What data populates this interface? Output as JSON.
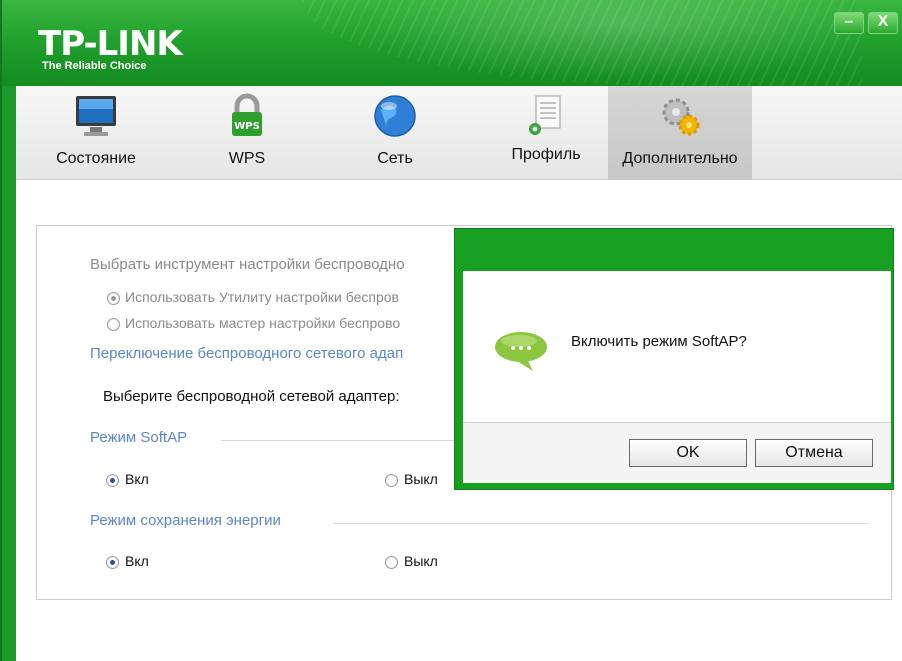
{
  "window": {
    "logo": "TP-LINK",
    "tagline": "The Reliable Choice",
    "minimize_glyph": "–",
    "close_glyph": "X"
  },
  "tabs": [
    {
      "label": "Состояние",
      "icon": "monitor-icon",
      "active": false
    },
    {
      "label": "WPS",
      "icon": "wps-lock-icon",
      "active": false
    },
    {
      "label": "Сеть",
      "icon": "globe-icon",
      "active": false
    },
    {
      "label": "Профиль",
      "icon": "profile-document-icon",
      "active": false
    },
    {
      "label": "Дополнительно",
      "icon": "gears-icon",
      "active": true
    }
  ],
  "panel": {
    "tool_heading": "Выбрать инструмент настройки беспроводно",
    "option_utility": "Использовать Утилиту настройки беспров",
    "option_wizard": "Использовать мастер настройки беспрово",
    "switch_adapter_heading": "Переключение беспроводного сетевого адап",
    "select_adapter_label": "Выберите беспроводной сетевой адаптер:",
    "softap_heading": "Режим SoftAP",
    "softap_on": "Вкл",
    "softap_off": "Выкл",
    "softap_value": "on",
    "power_heading": "Режим сохранения энергии",
    "power_on": "Вкл",
    "power_off": "Выкл",
    "power_value": "on"
  },
  "dialog": {
    "message": "Включить режим SoftAP?",
    "ok_label": "OK",
    "cancel_label": "Отмена",
    "icon": "speech-bubble-icon"
  },
  "colors": {
    "brand_green": "#1a9a2a",
    "section_blue": "#5a86c7"
  }
}
